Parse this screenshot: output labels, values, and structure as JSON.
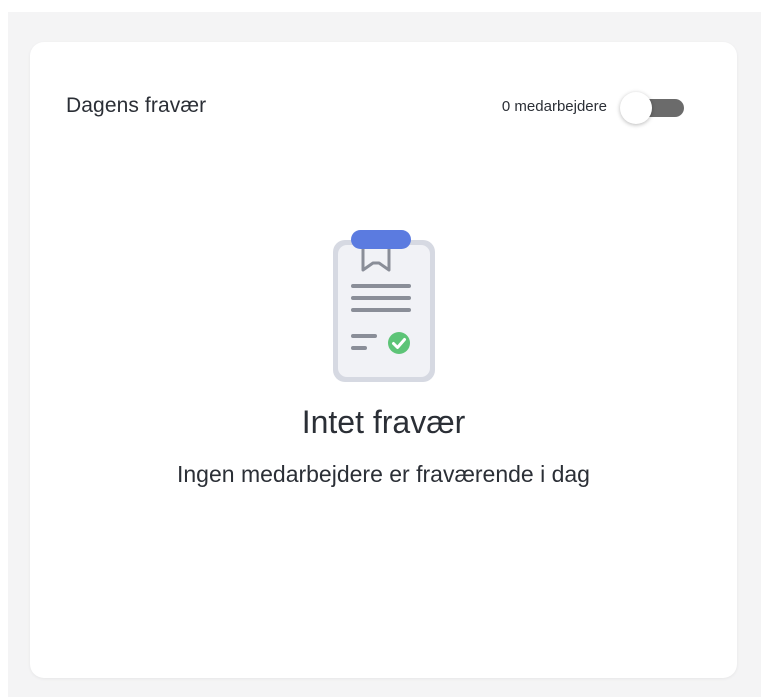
{
  "card": {
    "title": "Dagens fravær",
    "count_label": "0 medarbejdere",
    "toggle_on": false
  },
  "empty_state": {
    "icon": "clipboard-check-icon",
    "title": "Intet fravær",
    "subtitle": "Ingen medarbejdere er fraværende i dag"
  },
  "colors": {
    "clip_accent": "#5b7be0",
    "check_green": "#5dc477",
    "toggle_track": "#6b6b6b"
  }
}
